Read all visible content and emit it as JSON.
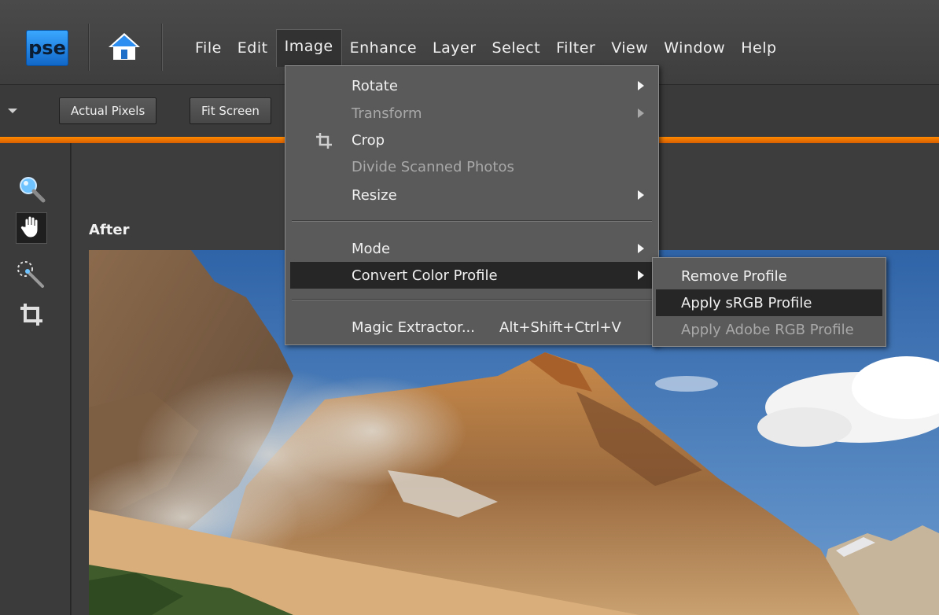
{
  "app": {
    "logo_text": "pse"
  },
  "menubar": {
    "items": [
      "File",
      "Edit",
      "Image",
      "Enhance",
      "Layer",
      "Select",
      "Filter",
      "View",
      "Window",
      "Help"
    ],
    "active": "Image"
  },
  "toolbar": {
    "actual_pixels": "Actual Pixels",
    "fit_screen": "Fit Screen"
  },
  "canvas": {
    "view_label": "After"
  },
  "image_menu": {
    "rotate": "Rotate",
    "transform": "Transform",
    "crop": "Crop",
    "divide": "Divide Scanned Photos",
    "resize": "Resize",
    "mode": "Mode",
    "convert": "Convert Color Profile",
    "magic": "Magic Extractor...",
    "magic_shortcut": "Alt+Shift+Ctrl+V"
  },
  "profile_submenu": {
    "remove": "Remove Profile",
    "apply_srgb": "Apply sRGB Profile",
    "apply_adobe": "Apply Adobe RGB Profile"
  },
  "colors": {
    "accent": "#ff8a00",
    "logo_blue": "#1f85e6",
    "highlight": "#262626"
  }
}
